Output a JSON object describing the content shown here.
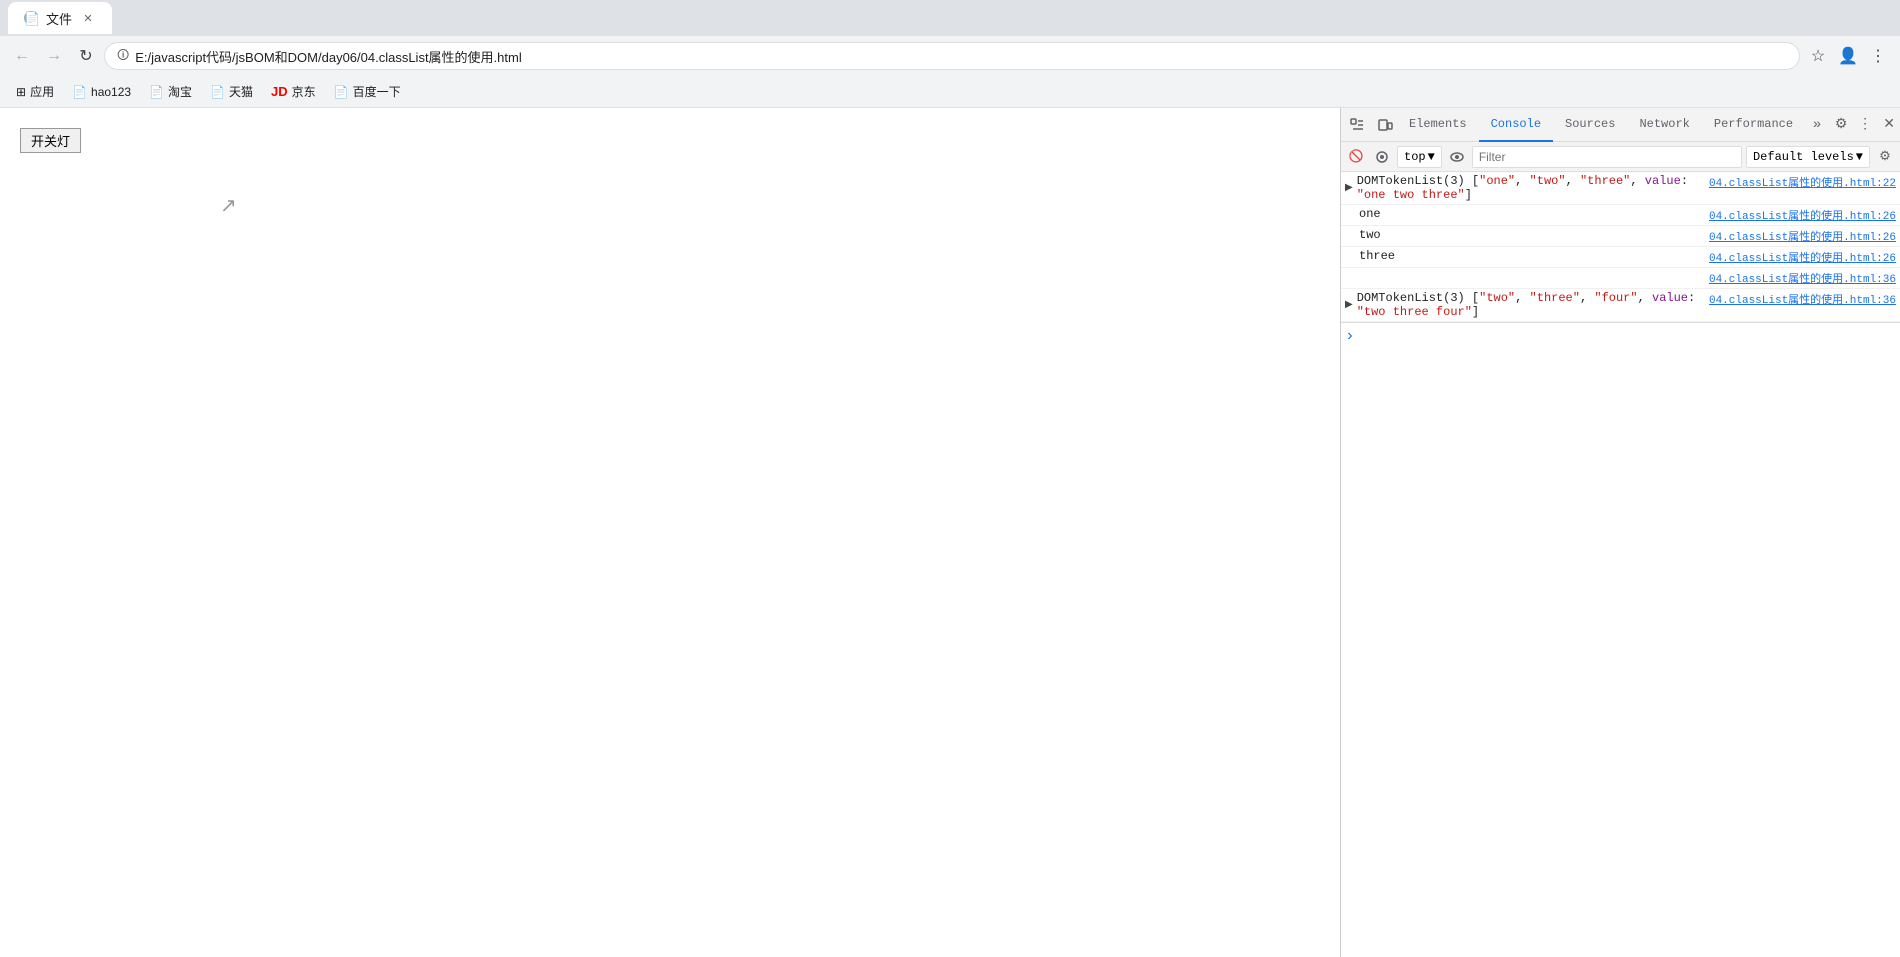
{
  "browser": {
    "url": "E:/javascript代码/jsBOM和DOM/day06/04.classList属性的使用.html",
    "favicon": "📄",
    "tab_title": "文件"
  },
  "toolbar": {
    "back_label": "←",
    "forward_label": "→",
    "reload_label": "↻",
    "home_label": "🏠"
  },
  "bookmarks": [
    {
      "label": "应用",
      "icon": "⊞"
    },
    {
      "label": "hao123",
      "icon": "📄"
    },
    {
      "label": "淘宝",
      "icon": "📄"
    },
    {
      "label": "天猫",
      "icon": "📄"
    },
    {
      "label": "京东",
      "icon": "🔴"
    },
    {
      "label": "百度一下",
      "icon": "📄"
    }
  ],
  "page": {
    "button_label": "开关灯"
  },
  "devtools": {
    "tabs": [
      {
        "label": "Elements",
        "active": false
      },
      {
        "label": "Console",
        "active": true
      },
      {
        "label": "Sources",
        "active": false
      },
      {
        "label": "Network",
        "active": false
      },
      {
        "label": "Performance",
        "active": false
      }
    ],
    "console": {
      "context": "top",
      "filter_placeholder": "Filter",
      "levels_label": "Default levels",
      "lines": [
        {
          "id": "line1",
          "source": "04.classList属性的使用.html:22",
          "has_arrow": true,
          "content_type": "domtokenlist",
          "text": "DOMTokenList(3) [\"one\", \"two\", \"three\", value: \"one two three\"]"
        },
        {
          "id": "line2",
          "source": "04.classList属性的使用.html:26",
          "has_arrow": false,
          "content_type": "plain",
          "text": "one"
        },
        {
          "id": "line3",
          "source": "04.classList属性的使用.html:26",
          "has_arrow": false,
          "content_type": "plain",
          "text": "two"
        },
        {
          "id": "line4",
          "source": "04.classList属性的使用.html:26",
          "has_arrow": false,
          "content_type": "plain",
          "text": "three"
        },
        {
          "id": "line5",
          "source": "04.classList属性的使用.html:36",
          "has_arrow": false,
          "content_type": "empty",
          "text": ""
        },
        {
          "id": "line6",
          "source": "04.classList属性的使用.html:36",
          "has_arrow": true,
          "content_type": "domtokenlist",
          "text": "DOMTokenList(3) [\"two\", \"three\", \"four\", value: \"two three four\"]"
        }
      ]
    }
  }
}
